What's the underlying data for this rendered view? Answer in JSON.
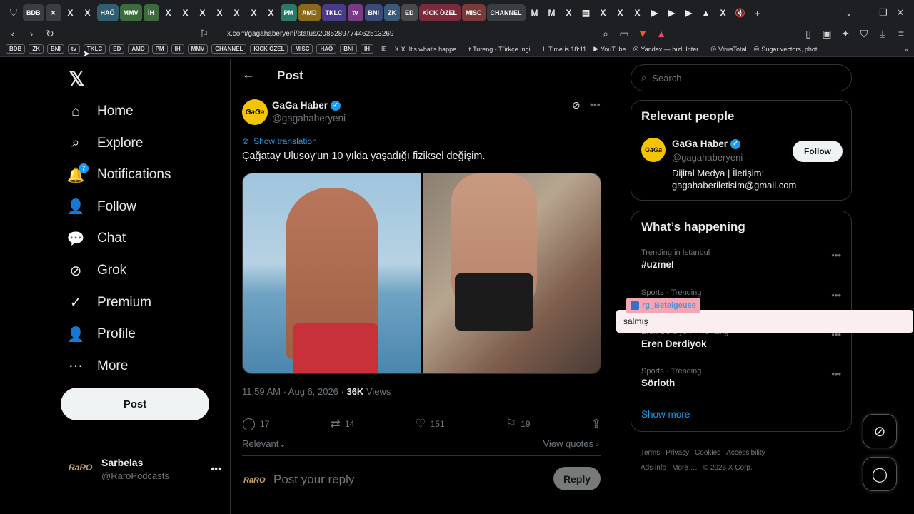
{
  "browser": {
    "tabs": [
      {
        "label": "BDB",
        "color": "#3a3d42",
        "kind": "label"
      },
      {
        "label": "✕",
        "color": "#3a3d42",
        "kind": "label"
      },
      {
        "label": "X",
        "color": "",
        "kind": "x"
      },
      {
        "label": "X",
        "color": "",
        "kind": "x"
      },
      {
        "label": "HAÖ",
        "color": "#2f5f6f",
        "kind": "label"
      },
      {
        "label": "MMV",
        "color": "#3d6b3d",
        "kind": "label"
      },
      {
        "label": "İH",
        "color": "#3d6b3d",
        "kind": "label"
      },
      {
        "label": "X",
        "color": "",
        "kind": "x"
      },
      {
        "label": "X",
        "color": "",
        "kind": "x"
      },
      {
        "label": "X",
        "color": "",
        "kind": "x"
      },
      {
        "label": "X",
        "color": "",
        "kind": "x"
      },
      {
        "label": "X",
        "color": "",
        "kind": "x"
      },
      {
        "label": "X",
        "color": "",
        "kind": "x"
      },
      {
        "label": "X",
        "color": "",
        "kind": "x"
      },
      {
        "label": "PM",
        "color": "#2a7a6a",
        "kind": "label"
      },
      {
        "label": "AMD",
        "color": "#8a6a1a",
        "kind": "label"
      },
      {
        "label": "TKLC",
        "color": "#4a3a8a",
        "kind": "label"
      },
      {
        "label": "tv",
        "color": "#7a3a8a",
        "kind": "label"
      },
      {
        "label": "BNI",
        "color": "#3a4a7a",
        "kind": "label"
      },
      {
        "label": "ZK",
        "color": "#3a5a7a",
        "kind": "label"
      },
      {
        "label": "ED",
        "color": "#4a4a4a",
        "kind": "label"
      },
      {
        "label": "KİCK ÖZEL",
        "color": "#7a2a3a",
        "kind": "label"
      },
      {
        "label": "MISC",
        "color": "#7a3a3a",
        "kind": "label"
      },
      {
        "label": "CHANNEL",
        "color": "#3a3d42",
        "kind": "label"
      },
      {
        "label": "M",
        "color": "",
        "kind": "x"
      },
      {
        "label": "M",
        "color": "",
        "kind": "x"
      },
      {
        "label": "X",
        "color": "",
        "kind": "x"
      },
      {
        "label": "▤",
        "color": "",
        "kind": "x"
      },
      {
        "label": "X",
        "color": "",
        "kind": "x"
      },
      {
        "label": "X",
        "color": "",
        "kind": "x"
      },
      {
        "label": "X",
        "color": "",
        "kind": "x"
      },
      {
        "label": "▶",
        "color": "",
        "kind": "x"
      },
      {
        "label": "▶",
        "color": "",
        "kind": "x"
      },
      {
        "label": "▶",
        "color": "",
        "kind": "x"
      },
      {
        "label": "▲",
        "color": "",
        "kind": "x"
      },
      {
        "label": "X",
        "color": "",
        "kind": "x"
      },
      {
        "label": "🔇",
        "color": "",
        "kind": "x"
      }
    ],
    "new_tab": "+",
    "url": "x.com/gagahaberyeni/status/2085289774462513269",
    "bookmarks": [
      "BDB",
      "ZK",
      "BNI",
      "tv",
      "TKLC",
      "ED",
      "AMD",
      "PM",
      "İH",
      "MMV",
      "CHANNEL",
      "KİCK ÖZEL",
      "MISC",
      "HAÖ",
      "BNİ",
      "İH"
    ],
    "bookmark_links": [
      {
        "icon": "X",
        "label": "X. It's what's happe..."
      },
      {
        "icon": "t",
        "label": "Tureng - Türkçe İngi..."
      },
      {
        "icon": "L",
        "label": "Time.is 18:11"
      },
      {
        "icon": "▶",
        "label": "YouTube"
      },
      {
        "icon": "◎",
        "label": "Yandex — hızlı İnter..."
      },
      {
        "icon": "◎",
        "label": "VirusTotal"
      },
      {
        "icon": "◎",
        "label": "Sugar vectors, phot..."
      }
    ]
  },
  "sidebar": {
    "logo": "𝕏",
    "items": [
      {
        "label": "Home",
        "icon": "⌂"
      },
      {
        "label": "Explore",
        "icon": "⌕"
      },
      {
        "label": "Notifications",
        "icon": "🔔"
      },
      {
        "label": "Follow",
        "icon": "👤"
      },
      {
        "label": "Chat",
        "icon": "💬"
      },
      {
        "label": "Grok",
        "icon": "⊘"
      },
      {
        "label": "Premium",
        "icon": "✓"
      },
      {
        "label": "Profile",
        "icon": "👤"
      },
      {
        "label": "More",
        "icon": "⋯"
      }
    ],
    "notif_count": "7",
    "post_label": "Post",
    "account": {
      "name": "Sarbelas",
      "handle": "@RaroPodcasts",
      "avatar_text": "RaRO"
    }
  },
  "main": {
    "title": "Post",
    "author": {
      "name": "GaGa Haber",
      "handle": "@gagahaberyeni",
      "avatar_text": "GaGa"
    },
    "show_translation": "Show translation",
    "text": "Çağatay Ulusoy'un 10 yılda yaşadığı fiziksel değişim.",
    "meta_time": "11:59 AM · Aug 6, 2026 · ",
    "views_count": "36K",
    "views_label": " Views",
    "actions": {
      "replies": "17",
      "reposts": "14",
      "likes": "151",
      "bookmarks": "19"
    },
    "sort_label": "Relevant",
    "view_quotes": "View quotes",
    "reply_placeholder": "Post your reply",
    "reply_button": "Reply",
    "reply_avatar_text": "RaRO"
  },
  "right": {
    "search_placeholder": "Search",
    "relevant_title": "Relevant people",
    "person": {
      "name": "GaGa Haber",
      "handle": "@gagahaberyeni",
      "bio": "Dijital Medya | İletişim: gagahaberiletisim@gmail.com",
      "follow": "Follow",
      "avatar_text": "GaGa"
    },
    "happening_title": "What’s happening",
    "trends": [
      {
        "category": "Trending in İstanbul",
        "tag": "#uzmel"
      },
      {
        "category": "Sports · Trending",
        "tag": ""
      },
      {
        "category": "Eren Derdiyok · Trending",
        "tag": "Eren Derdiyok"
      },
      {
        "category": "Sports · Trending",
        "tag": "Sörloth"
      }
    ],
    "show_more": "Show more",
    "footer": [
      "Terms",
      "Privacy",
      "Cookies",
      "Accessibility",
      "Ads info",
      "More …",
      "© 2026 X Corp."
    ]
  },
  "overlay": {
    "user": "rg_Betelgeuse",
    "message": "salmış"
  }
}
